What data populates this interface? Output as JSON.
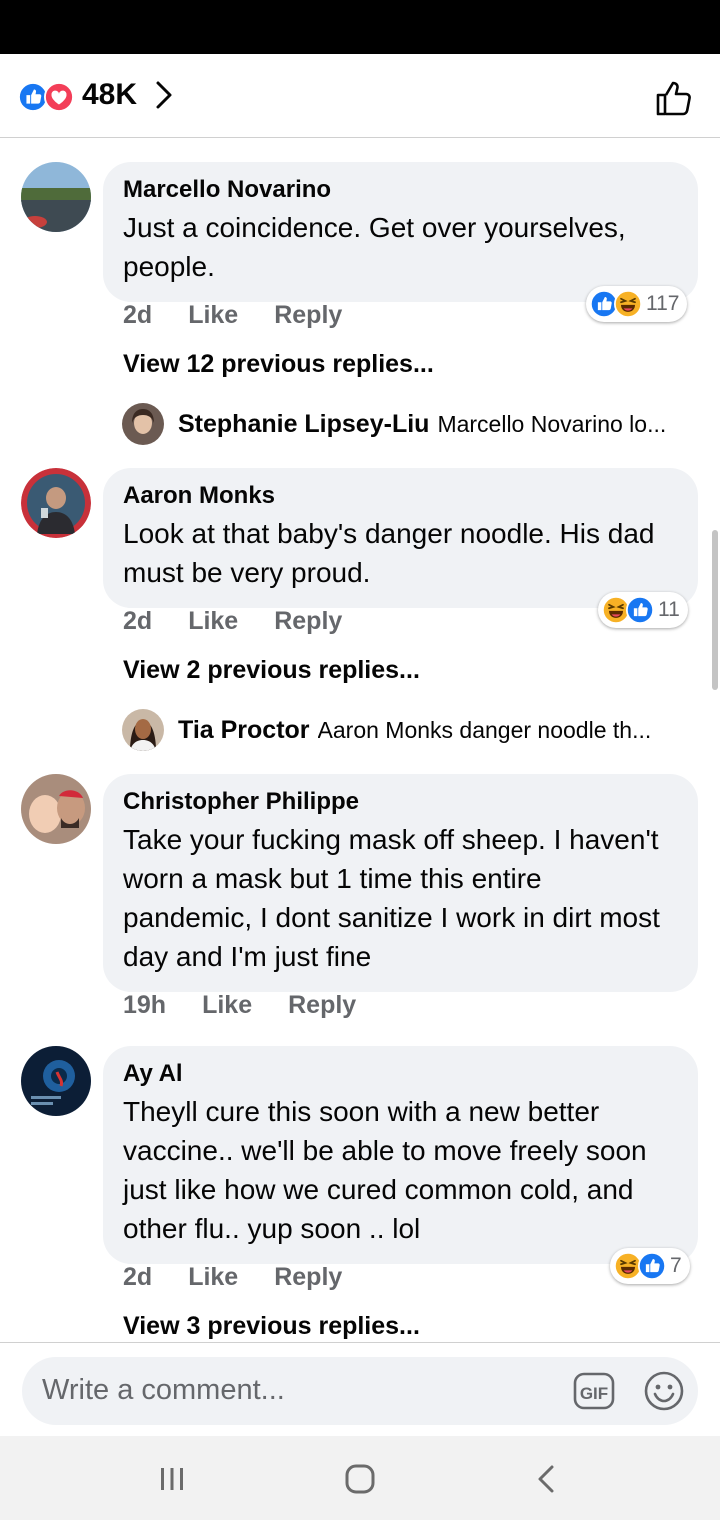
{
  "reactions_summary": {
    "count": "48K",
    "icons": [
      "like-icon",
      "love-icon"
    ]
  },
  "comments": [
    {
      "author": "Marcello Novarino",
      "text": "Just a coincidence. Get over yourselves, people.",
      "time": "2d",
      "like": "Like",
      "reply": "Reply",
      "reaction_count": "117",
      "view_replies": "View 12 previous replies...",
      "latest_reply": {
        "author": "Stephanie Lipsey-Liu",
        "text": "Marcello Novarino lo..."
      }
    },
    {
      "author": "Aaron Monks",
      "text": "Look at that baby's danger noodle. His dad must be very proud.",
      "time": "2d",
      "like": "Like",
      "reply": "Reply",
      "reaction_count": "11",
      "view_replies": "View 2 previous replies...",
      "latest_reply": {
        "author": "Tia Proctor",
        "text": "Aaron Monks danger noodle  th..."
      }
    },
    {
      "author": "Christopher Philippe",
      "text": "Take your fucking mask off sheep. I haven't worn a mask but 1 time this entire pandemic, I dont sanitize I work in dirt most day and I'm just fine",
      "time": "19h",
      "like": "Like",
      "reply": "Reply"
    },
    {
      "author": "Ay Al",
      "text": "Theyll cure this soon with a new better vaccine.. we'll be able to move freely soon just like how we cured common cold, and other flu.. yup soon .. lol",
      "time": "2d",
      "like": "Like",
      "reply": "Reply",
      "reaction_count": "7",
      "view_replies": "View 3 previous replies..."
    }
  ],
  "composer": {
    "placeholder": "Write a comment...",
    "gif_label": "GIF"
  },
  "colors": {
    "like_blue": "#1877f2",
    "love_red": "#f33e58",
    "haha_yellow": "#f7b125",
    "bubble_gray": "#f0f2f5",
    "meta_gray": "#65676b"
  }
}
